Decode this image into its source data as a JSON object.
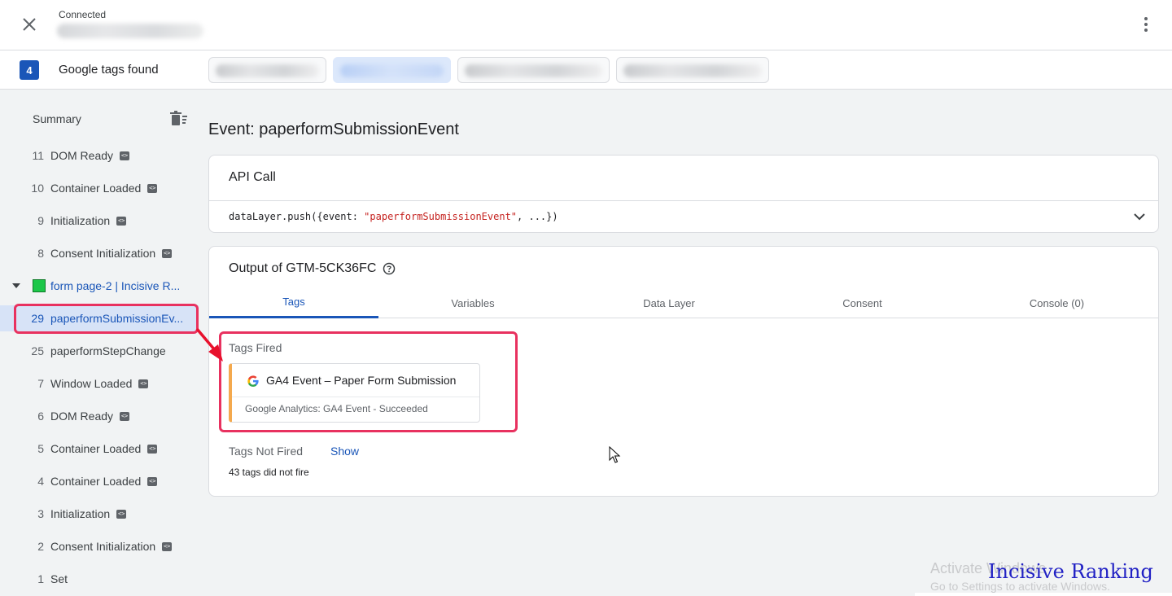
{
  "topbar": {
    "status": "Connected",
    "url_redacted": true
  },
  "tagsbar": {
    "count": "4",
    "label": "Google tags found",
    "chips": [
      {
        "active": false
      },
      {
        "active": true
      },
      {
        "active": false
      },
      {
        "active": false
      }
    ]
  },
  "sidebar": {
    "summary": "Summary",
    "items_before": [
      {
        "num": "11",
        "label": "DOM Ready",
        "code": true
      },
      {
        "num": "10",
        "label": "Container Loaded",
        "code": true
      },
      {
        "num": "9",
        "label": "Initialization",
        "code": true
      },
      {
        "num": "8",
        "label": "Consent Initialization",
        "code": true
      }
    ],
    "page": {
      "label": "form page-2 | Incisive R..."
    },
    "items_after": [
      {
        "num": "29",
        "label": "paperformSubmissionEv...",
        "code": false,
        "selected": true
      },
      {
        "num": "25",
        "label": "paperformStepChange",
        "code": false
      },
      {
        "num": "7",
        "label": "Window Loaded",
        "code": true
      },
      {
        "num": "6",
        "label": "DOM Ready",
        "code": true
      },
      {
        "num": "5",
        "label": "Container Loaded",
        "code": true
      },
      {
        "num": "4",
        "label": "Container Loaded",
        "code": true
      },
      {
        "num": "3",
        "label": "Initialization",
        "code": true
      },
      {
        "num": "2",
        "label": "Consent Initialization",
        "code": true
      },
      {
        "num": "1",
        "label": "Set",
        "code": false
      }
    ]
  },
  "main": {
    "event_title": "Event: paperformSubmissionEvent",
    "api": {
      "title": "API Call",
      "code_prefix": "dataLayer.push({event: ",
      "code_string": "\"paperformSubmissionEvent\"",
      "code_suffix": ", ...})"
    },
    "output": {
      "title": "Output of GTM-5CK36FC",
      "tabs": [
        "Tags",
        "Variables",
        "Data Layer",
        "Consent",
        "Console (0)"
      ],
      "active_tab": "Tags",
      "tags_fired_label": "Tags Fired",
      "fired_tag": {
        "name": "GA4 Event – Paper Form Submission",
        "sub": "Google Analytics: GA4 Event - Succeeded"
      },
      "not_fired_label": "Tags Not Fired",
      "show_label": "Show",
      "not_fired_count": "43 tags did not fire"
    }
  },
  "overlay": {
    "activate_1": "Activate Windows",
    "activate_2": "Go to Settings to activate Windows.",
    "watermark": "Incisive Ranking"
  },
  "colors": {
    "accent": "#1a56b8",
    "highlight": "#e8315f",
    "tag_border": "#f4a94e",
    "page_marker": "#1cc749"
  }
}
